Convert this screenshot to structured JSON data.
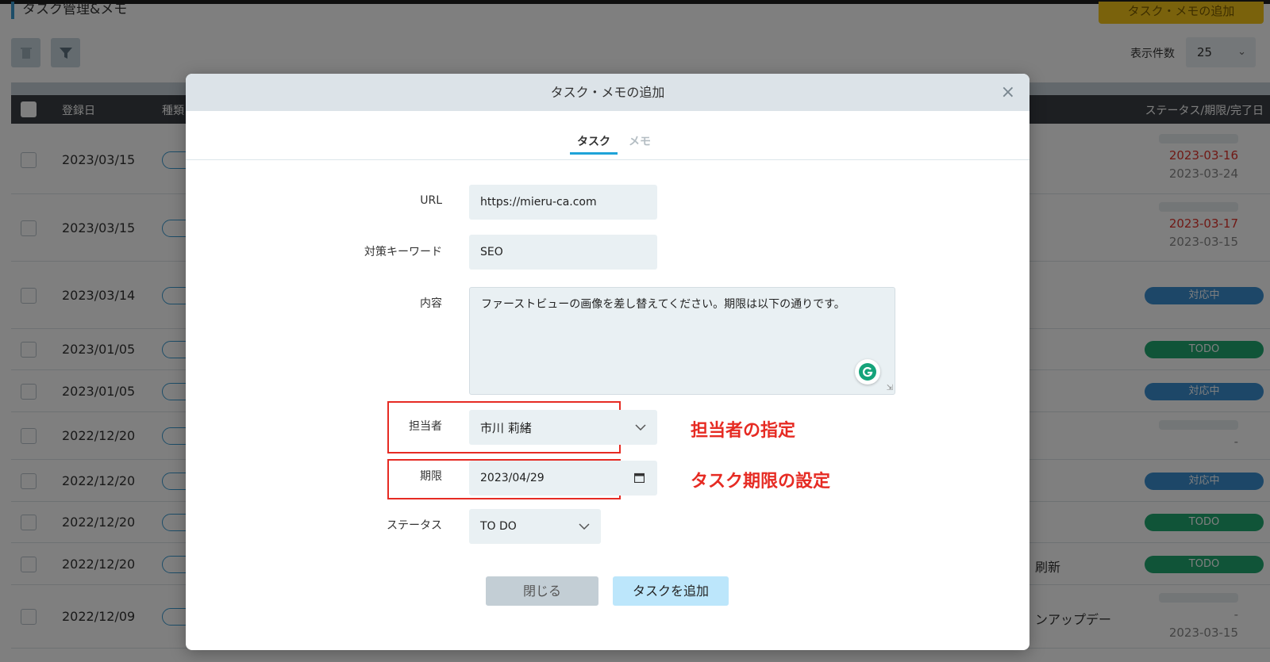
{
  "background": {
    "page_title": "タスク管理&メモ",
    "add_button_label": "タスク・メモの追加",
    "per_page_label": "表示件数",
    "per_page_value": "25",
    "columns": [
      "登録日",
      "種類",
      "ステータス/期限/完了日"
    ],
    "rows": [
      {
        "date": "2023/03/15",
        "status_red": "2023-03-16",
        "status_gray": "2023-03-24",
        "extra": ""
      },
      {
        "date": "2023/03/15",
        "status_red": "2023-03-17",
        "status_gray": "2023-03-15",
        "extra": ""
      },
      {
        "date": "2023/03/14",
        "badge": "対応中",
        "badge_color": "blue",
        "extra": ""
      },
      {
        "date": "2023/01/05",
        "badge": "TODO",
        "badge_color": "green",
        "extra": ""
      },
      {
        "date": "2023/01/05",
        "badge": "対応中",
        "badge_color": "blue",
        "extra": ""
      },
      {
        "date": "2022/12/20",
        "status_gray": "-",
        "extra": ""
      },
      {
        "date": "2022/12/20",
        "badge": "対応中",
        "badge_color": "blue",
        "extra": ""
      },
      {
        "date": "2022/12/20",
        "badge": "TODO",
        "badge_color": "green",
        "extra": ""
      },
      {
        "date": "2022/12/20",
        "badge": "TODO",
        "badge_color": "green",
        "extra": "刷新"
      },
      {
        "date": "2022/12/09",
        "status_gray": "-",
        "status_gray2": "2023-03-15",
        "extra": "ンアップデー"
      }
    ]
  },
  "modal": {
    "title": "タスク・メモの追加",
    "close_icon": "×",
    "tabs": {
      "task": "タスク",
      "memo": "メモ"
    },
    "fields": {
      "url": {
        "label": "URL",
        "value": "https://mieru-ca.com"
      },
      "keyword": {
        "label": "対策キーワード",
        "value": "SEO"
      },
      "content": {
        "label": "内容",
        "value": "ファーストビューの画像を差し替えてください。期限は以下の通りです。"
      },
      "assignee": {
        "label": "担当者",
        "value": "市川 莉緒"
      },
      "deadline": {
        "label": "期限",
        "value": "2023/04/29"
      },
      "status": {
        "label": "ステータス",
        "value": "TO DO"
      }
    },
    "buttons": {
      "close": "閉じる",
      "add": "タスクを追加"
    }
  },
  "annotations": {
    "assignee": "担当者の指定",
    "deadline": "タスク期限の設定"
  },
  "colors": {
    "annotation_red": "#e62b23",
    "accent_blue": "#1fa3d8",
    "badge_blue": "#3b8fd0",
    "badge_green": "#21a870",
    "brand_yellow": "#f5c518"
  }
}
